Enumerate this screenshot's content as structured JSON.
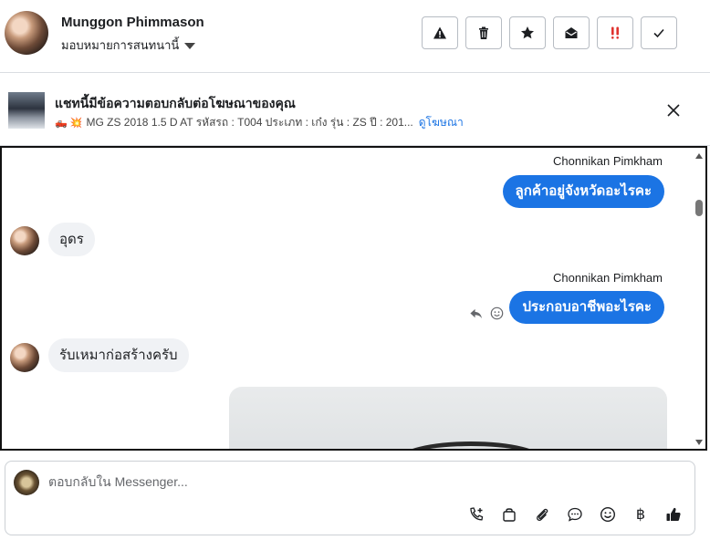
{
  "header": {
    "name": "Munggon Phimmason",
    "assign_label": "มอบหมายการสนทนานี้",
    "actions": [
      "report-icon",
      "trash-icon",
      "star-icon",
      "mark-unread-icon",
      "important-icon",
      "done-icon"
    ]
  },
  "ad": {
    "title": "แชทนี้มีข้อความตอบกลับต่อโฆษณาของคุณ",
    "description": "MG ZS 2018 1.5 D AT รหัสรถ : T004 ประเภท : เก๋ง รุ่น : ZS ปี : 201...",
    "emoji": "🛻 💥",
    "link": "ดูโฆษณา"
  },
  "messages": [
    {
      "direction": "out",
      "sender": "Chonnikan Pimkham",
      "text": "ลูกค้าอยู่จังหวัดอะไรคะ"
    },
    {
      "direction": "in",
      "text": "อุดร"
    },
    {
      "direction": "out",
      "sender": "Chonnikan Pimkham",
      "text": "ประกอบอาชีพอะไรคะ"
    },
    {
      "direction": "in",
      "text": "รับเหมาก่อสร้างครับ"
    }
  ],
  "composer": {
    "placeholder": "ตอบกลับใน Messenger...",
    "currency_symbol": "฿"
  }
}
